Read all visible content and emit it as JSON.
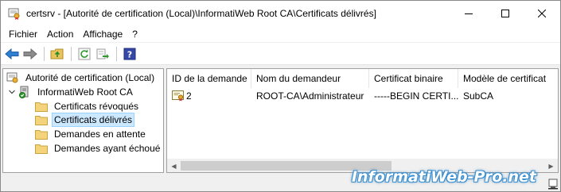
{
  "window": {
    "title": "certsrv - [Autorité de certification (Local)\\InformatiWeb Root CA\\Certificats délivrés]"
  },
  "menu": {
    "items": [
      "Fichier",
      "Action",
      "Affichage",
      "?"
    ]
  },
  "tree": {
    "root": "Autorité de certification (Local)",
    "ca": "InformatiWeb Root CA",
    "folders": [
      "Certificats révoqués",
      "Certificats délivrés",
      "Demandes en attente",
      "Demandes ayant échoué"
    ],
    "selected_index": 1
  },
  "list": {
    "columns": [
      "ID de la demande",
      "Nom du demandeur",
      "Certificat binaire",
      "Modèle de certificat"
    ],
    "rows": [
      [
        "2",
        "ROOT-CA\\Administrateur",
        "-----BEGIN CERTI...",
        "SubCA"
      ]
    ]
  },
  "watermark": "InformatiWeb-Pro.net",
  "colors": {
    "selection": "#cce8ff",
    "selection_border": "#99d1ff",
    "watermark_outline": "#3a8fd0"
  },
  "icons": {
    "back": "arrow-left-icon",
    "forward": "arrow-right-icon",
    "up": "folder-up-icon",
    "refresh": "refresh-icon",
    "export": "export-list-icon",
    "help": "help-icon"
  }
}
